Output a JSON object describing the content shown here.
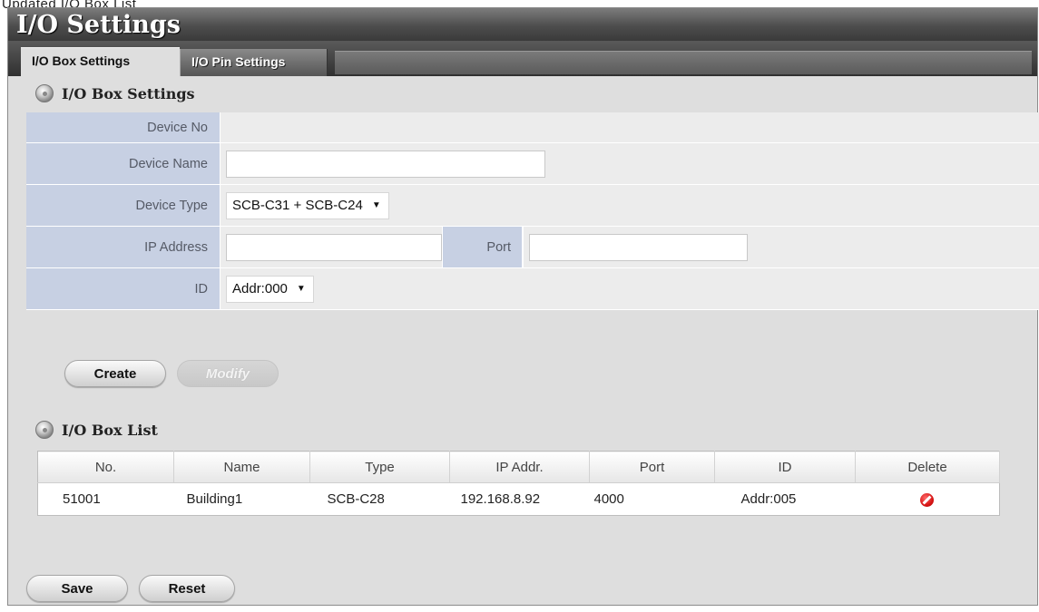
{
  "caption": "Updated I/O Box List",
  "window": {
    "title": "I/O Settings"
  },
  "tabs": [
    {
      "label": "I/O Box Settings",
      "active": true
    },
    {
      "label": "I/O Pin Settings",
      "active": false
    }
  ],
  "settings": {
    "heading": "I/O Box Settings",
    "device_no": {
      "label": "Device No",
      "value": ""
    },
    "device_name": {
      "label": "Device Name",
      "value": ""
    },
    "device_type": {
      "label": "Device Type",
      "value": "SCB-C31 + SCB-C24"
    },
    "ip_address": {
      "label": "IP Address",
      "value": ""
    },
    "port": {
      "label": "Port",
      "value": ""
    },
    "id": {
      "label": "ID",
      "value": "Addr:000"
    }
  },
  "actions": {
    "create": "Create",
    "modify": "Modify"
  },
  "list": {
    "heading": "I/O Box List",
    "columns": [
      "No.",
      "Name",
      "Type",
      "IP Addr.",
      "Port",
      "ID",
      "Delete"
    ],
    "rows": [
      {
        "no": "51001",
        "name": "Building1",
        "type": "SCB-C28",
        "ip": "192.168.8.92",
        "port": "4000",
        "id": "Addr:005"
      }
    ]
  },
  "footer": {
    "save": "Save",
    "reset": "Reset"
  },
  "colors": {
    "label_bg": "#c7d0e3",
    "title_bg": "#4d4d4d",
    "delete_icon": "#d71515"
  }
}
